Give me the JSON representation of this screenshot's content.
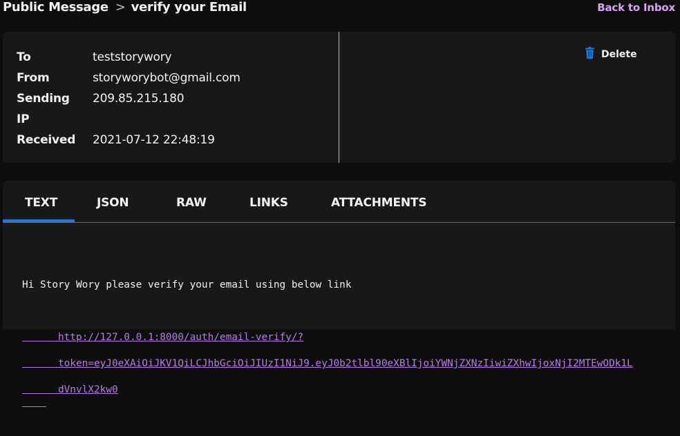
{
  "breadcrumb": {
    "root": "Public Message",
    "separator": ">",
    "current": "verify your Email"
  },
  "back_link": "Back to Inbox",
  "header": {
    "fields": [
      {
        "key": "To",
        "value": "teststorywory"
      },
      {
        "key": "From",
        "value": "storyworybot@gmail.com"
      },
      {
        "key": "Sending",
        "value": "209.85.215.180"
      },
      {
        "key": "IP",
        "value": ""
      },
      {
        "key": "Received",
        "value": "2021-07-12 22:48:19"
      }
    ],
    "delete_label": "Delete"
  },
  "tabs": [
    {
      "label": "TEXT",
      "active": true
    },
    {
      "label": "JSON",
      "active": false
    },
    {
      "label": "RAW",
      "active": false
    },
    {
      "label": "LINKS",
      "active": false
    },
    {
      "label": "ATTACHMENTS",
      "active": false
    }
  ],
  "message": {
    "line1": "Hi Story Wory please verify your email using below link",
    "link_line1": "http://127.0.0.1:8000/auth/email-verify/?",
    "link_line2": "token=eyJ0eXAiOiJKV1QiLCJhbGciOiJIUzI1NiJ9.eyJ0b2tlbl90eXBlIjoiYWNjZXNzIiwiZXhwIjoxNjI2MTEwODk1L",
    "link_line3": "dVnvlX2kw0"
  },
  "colors": {
    "accent": "#1f7ae0",
    "link": "#b87ce8",
    "back_link": "#d8a3f2",
    "card": "#18181b",
    "background": "#0e0e0f"
  }
}
